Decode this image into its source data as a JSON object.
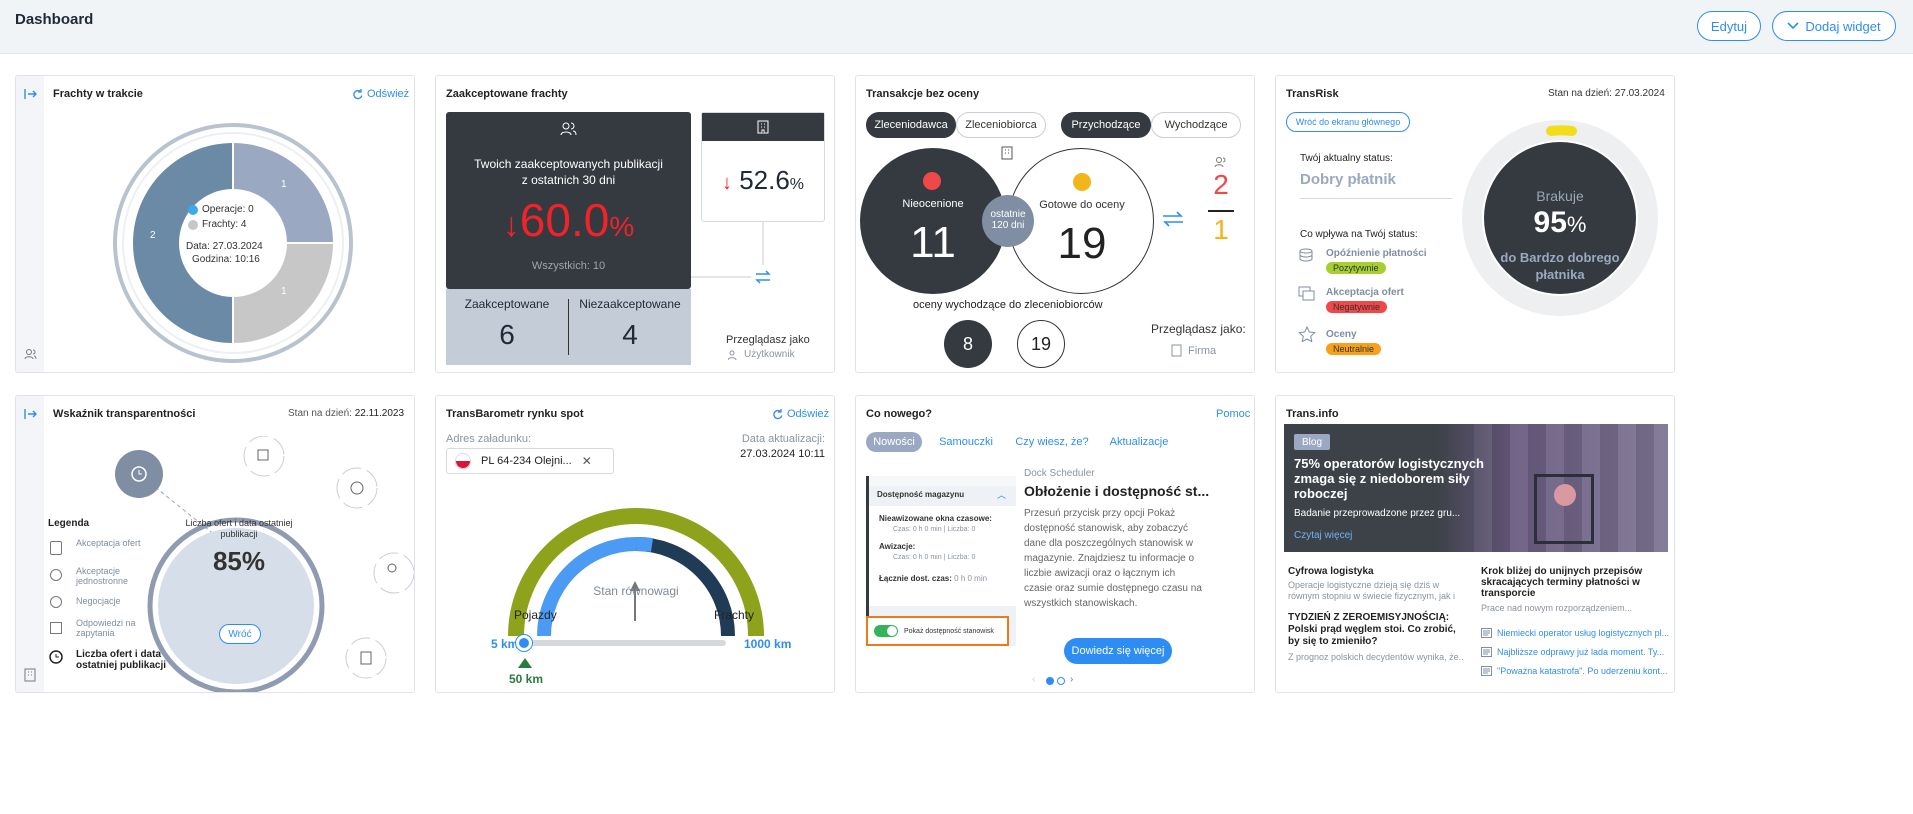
{
  "header": {
    "title": "Dashboard",
    "edit": "Edytuj",
    "add_widget": "Dodaj widget"
  },
  "frachty": {
    "title": "Frachty w trakcie",
    "refresh": "Odśwież",
    "operacje": "Operacje: 0",
    "frachty": "Frachty: 4",
    "data": "Data: 27.03.2024",
    "godzina": "Godzina: 10:16",
    "seg_left": "2",
    "seg_tr": "1",
    "seg_br": "1",
    "colors": {
      "outer": "#b8c3cf",
      "left": "#6b8aa6",
      "tr": "#9aa9c1",
      "br": "#c7c7c7"
    }
  },
  "zaakc": {
    "title": "Zaakceptowane frachty",
    "line1": "Twoich zaakceptowanych publikacji",
    "line2": "z ostatnich 30 dni",
    "pct": "60.0",
    "pct_unit": "%",
    "all": "Wszystkich: 10",
    "small_pct": "52.6",
    "small_unit": "%",
    "accepted_label": "Zaakceptowane",
    "accepted": "6",
    "notaccepted_label": "Niezaakceptowane",
    "notaccepted": "4",
    "viewing": "Przeglądasz jako",
    "role": "Użytkownik"
  },
  "transakcje": {
    "title": "Transakcje bez oceny",
    "tabs_a": [
      "Zleceniodawca",
      "Zleceniobiorca"
    ],
    "tabs_b": [
      "Przychodzące",
      "Wychodzące"
    ],
    "nieocenione": "Nieocenione",
    "n1": "11",
    "gotowe": "Gotowe do oceny",
    "n2": "19",
    "mid1": "ostatnie",
    "mid2": "120 dni",
    "r1": "2",
    "r2": "1",
    "out_label": "oceny wychodzące do zleceniobiorców",
    "o1": "8",
    "o2": "19",
    "viewing": "Przeglądasz jako:",
    "role": "Firma"
  },
  "transrisk": {
    "title": "TransRisk",
    "date": "Stan na dzień: 27.03.2024",
    "back": "Wróć do ekranu głównego",
    "status_label": "Twój aktualny status:",
    "status": "Dobry płatnik",
    "influence": "Co wpływa na Twój status:",
    "items": [
      {
        "name": "Opóźnienie płatności",
        "badge": "Pozytywnie",
        "color": "#a5d02f"
      },
      {
        "name": "Akceptacja ofert",
        "badge": "Negatywnie",
        "color": "#f04848"
      },
      {
        "name": "Oceny",
        "badge": "Neutralnie",
        "color": "#f7a11a"
      }
    ],
    "brakuje": "Brakuje",
    "pct": "95",
    "unit": "%",
    "to1": "do Bardzo dobrego",
    "to2": "płatnika"
  },
  "wskaznik": {
    "title": "Wskaźnik transparentności",
    "date_label": "Stan na dzień:",
    "date": "22.11.2023",
    "legend": "Legenda",
    "items": [
      "Akceptacja ofert",
      "Akceptacje jednostronne",
      "Negocjacje",
      "Odpowiedzi na zapytania",
      "Liczba ofert i data ostatniej publikacji"
    ],
    "circle1": "Liczba ofert i data ostatniej",
    "circle2": "publikacji",
    "pct": "85%",
    "back": "Wróć"
  },
  "barometr": {
    "title": "TransBarometr rynku spot",
    "refresh": "Odśwież",
    "addr_label": "Adres załadunku:",
    "addr": "PL 64-234 Olejni...",
    "upd_label": "Data aktualizacji:",
    "upd": "27.03.2024 10:11",
    "left": "Pojazdy",
    "right": "Frachty",
    "center": "Stan równowagi",
    "min": "5 km",
    "max": "1000 km",
    "val": "50 km"
  },
  "nowosci": {
    "title": "Co nowego?",
    "help": "Pomoc",
    "tabs": [
      "Nowości",
      "Samouczki",
      "Czy wiesz, że?",
      "Aktualizacje"
    ],
    "panel_title": "Dostępność magazynu",
    "r1": "Nieawizowane okna czasowe:",
    "r1s": "Czas: 0 h 0 min | Liczba: 0",
    "r2": "Awizacje:",
    "r2s": "Czas: 0 h 0 min | Liczba: 0",
    "r3": "Łącznie dost. czas:",
    "r3s": "0 h 0 min",
    "toggle": "Pokaż dostępność stanowisk",
    "kicker": "Dock Scheduler",
    "head": "Obłożenie i dostępność st...",
    "body": "Przesuń przycisk przy opcji Pokaż dostępność stanowisk, aby zobaczyć dane dla poszczególnych stanowisk w magazynie. Znajdziesz tu informacje o liczbie awizacji oraz o łącznym ich czasie oraz sumie dostępnego czasu na wszystkich stanowiskach.",
    "cta": "Dowiedz się więcej"
  },
  "transinfo": {
    "title": "Trans.info",
    "tag": "Blog",
    "hero": "75% operatorów logistycznych zmaga się z niedoborem siły roboczej",
    "hero_sub": "Badanie przeprowadzone przez gru...",
    "read": "Czytaj więcej",
    "a1t": "Cyfrowa logistyka",
    "a1s": "Operacje logistyczne dzieją się dziś w równym stopniu w świecie fizycznym, jak i cyfrowym. Zarówno usługi z zakresu...",
    "a2t": "TYDZIEŃ Z ZEROEMISYJNOŚCIĄ: Polski prąd węglem stoi. Co zrobić, by się to zmieniło?",
    "a2s": "Z prognoz polskich decydentów wynika, że...",
    "b1t": "Krok bliżej do unijnych przepisów skracających terminy płatności w transporcie",
    "b1s": "Prace nad nowym rozporządzeniem...",
    "links": [
      "Niemiecki operator usług logistycznych pl...",
      "Najbliższe odprawy już lada moment. Ty...",
      "\"Poważna katastrofa\". Po uderzeniu kont..."
    ]
  }
}
